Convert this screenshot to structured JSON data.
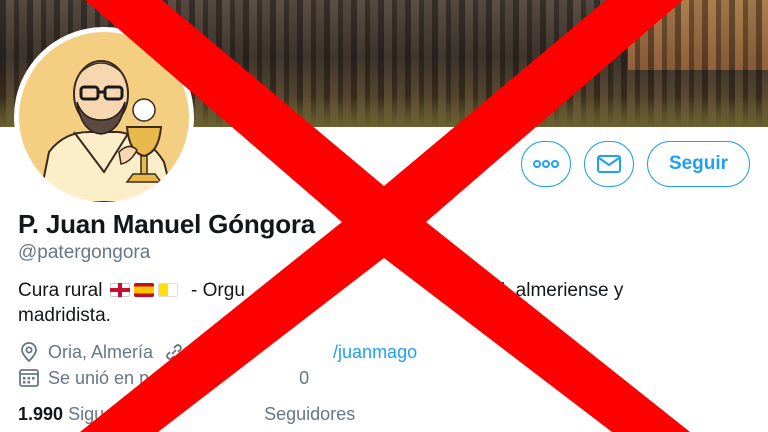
{
  "header": {
    "follow_label": "Seguir",
    "more_icon": "more-dots-icon",
    "message_icon": "envelope-icon"
  },
  "profile": {
    "name": "P. Juan Manuel Góngora",
    "handle": "@patergongora",
    "bio_start": "Cura rural",
    "bio_mid": "- Orgu",
    "bio_end": "l, almeriense y",
    "bio_line2": "madridista."
  },
  "meta": {
    "location": "Oria, Almería",
    "website_fragment": "/juanmago",
    "joined_prefix": "Se unió en n",
    "joined_suffix": "0"
  },
  "stats": {
    "following_count": "1.990",
    "following_fragment": "Sigu",
    "followers_label": "Seguidores"
  },
  "colors": {
    "accent": "#1da1f2",
    "overlay_x": "#ff0000",
    "avatar_bg": "#f4cf82"
  }
}
